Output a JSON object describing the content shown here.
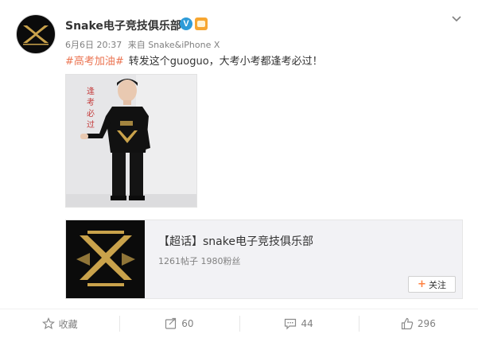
{
  "post": {
    "user_name": "Snake电子竞技俱乐部",
    "verified_badge": "V",
    "date": "6月6日 20:37",
    "source": "来自 Snake&iPhone X",
    "hashtag": "#高考加油#",
    "text": "转发这个guoguo，大考小考都逢考必过！",
    "photo_sign_text": "逢考必过"
  },
  "link_card": {
    "title": "【超话】snake电子竞技俱乐部",
    "stats": "1261帖子 1980粉丝",
    "follow_label": "关注",
    "follow_icon": "+"
  },
  "actions": [
    {
      "icon": "star-icon",
      "label": "收藏"
    },
    {
      "icon": "repost-icon",
      "label": "60"
    },
    {
      "icon": "comment-icon",
      "label": "44"
    },
    {
      "icon": "like-icon",
      "label": "296"
    }
  ],
  "colors": {
    "hashtag": "#eb7350",
    "verified": "#2d9bd8",
    "muted_text": "#808080",
    "card_bg": "#f2f2f5",
    "brand_gold": "#c9a24b"
  }
}
